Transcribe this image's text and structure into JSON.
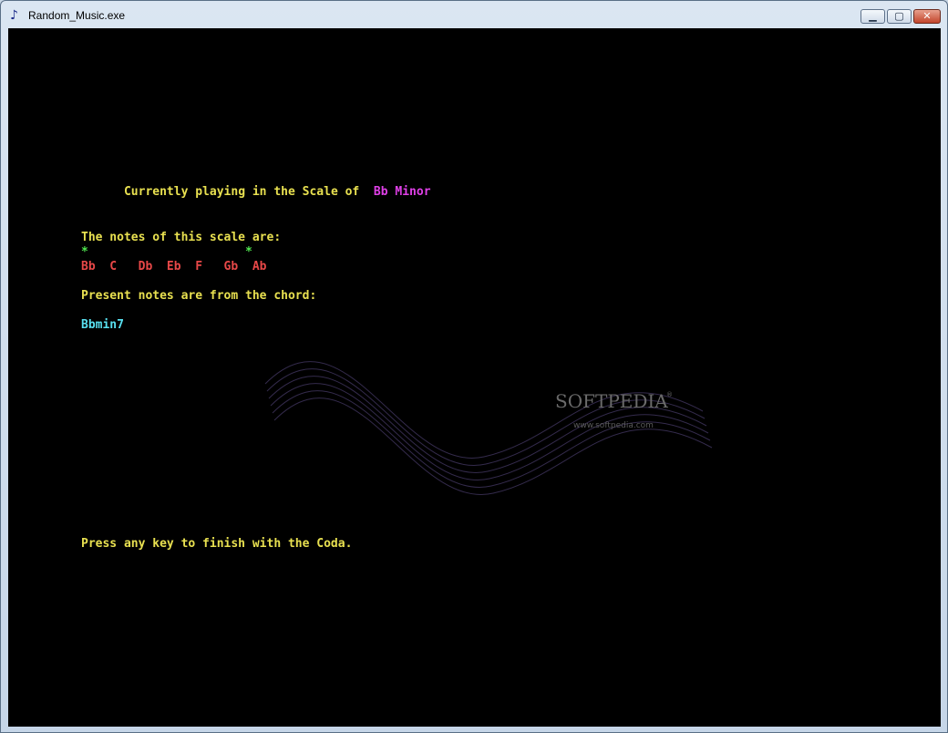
{
  "window": {
    "title": "Random_Music.exe",
    "controls": {
      "minimize": "▁",
      "maximize": "▢",
      "close": "✕"
    },
    "app_icon": "music-note-icon"
  },
  "console": {
    "scale_prefix": "Currently playing in the Scale of",
    "scale_name": "Bb Minor",
    "notes_heading": "The notes of this scale are:",
    "marker_line": "*                      *",
    "notes_line": "Bb  C   Db  Eb  F   Gb  Ab",
    "chord_heading": "Present notes are from the chord:",
    "chord_name": "Bbmin7",
    "prompt": "Press any key to finish with the Coda."
  },
  "watermark": {
    "brand": "SOFTPEDIA",
    "trademark": "®",
    "url": "www.softpedia.com"
  },
  "colors": {
    "background": "#000000",
    "text_yellow": "#e8e050",
    "scale_magenta": "#e040e8",
    "notes_red": "#e84848",
    "marker_green": "#50e850",
    "chord_cyan": "#58e0f0"
  }
}
